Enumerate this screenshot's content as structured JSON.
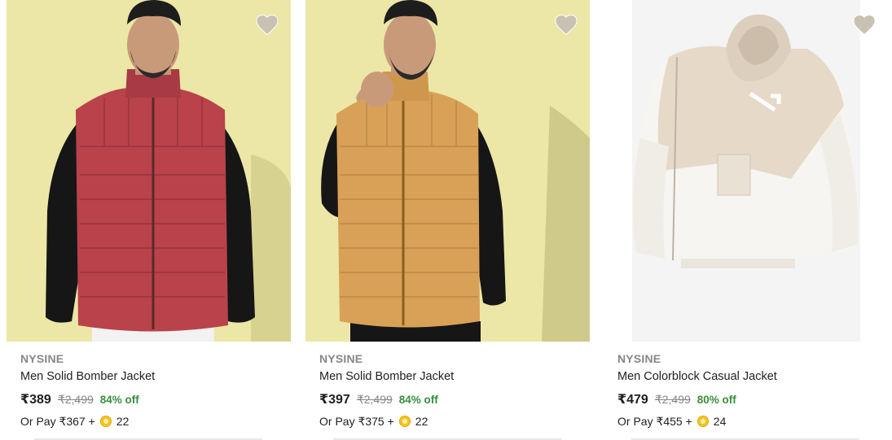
{
  "products": [
    {
      "brand": "NYSINE",
      "title": "Men Solid Bomber Jacket",
      "price": "₹389",
      "mrp": "₹2,499",
      "discount": "84% off",
      "pay_prefix": "Or Pay ₹367 +",
      "coins": "22",
      "image": "red-sleeveless-puffer-jacket",
      "color": "#b9424b"
    },
    {
      "brand": "NYSINE",
      "title": "Men Solid Bomber Jacket",
      "price": "₹397",
      "mrp": "₹2,499",
      "discount": "84% off",
      "pay_prefix": "Or Pay ₹375 +",
      "coins": "22",
      "image": "tan-sleeveless-puffer-jacket",
      "color": "#d9a157"
    },
    {
      "brand": "NYSINE",
      "title": "Men Colorblock Casual Jacket",
      "price": "₹479",
      "mrp": "₹2,499",
      "discount": "80% off",
      "pay_prefix": "Or Pay ₹455 +",
      "coins": "24",
      "image": "beige-white-colorblock-hooded-jacket",
      "color": "#e6d9c8"
    }
  ],
  "icons": {
    "wishlist": "heart-icon",
    "coin": "supercoin-icon"
  },
  "colors": {
    "discount_green": "#388e3c",
    "muted_gray": "#878787",
    "wishlist_gray": "#c8c2b5"
  }
}
